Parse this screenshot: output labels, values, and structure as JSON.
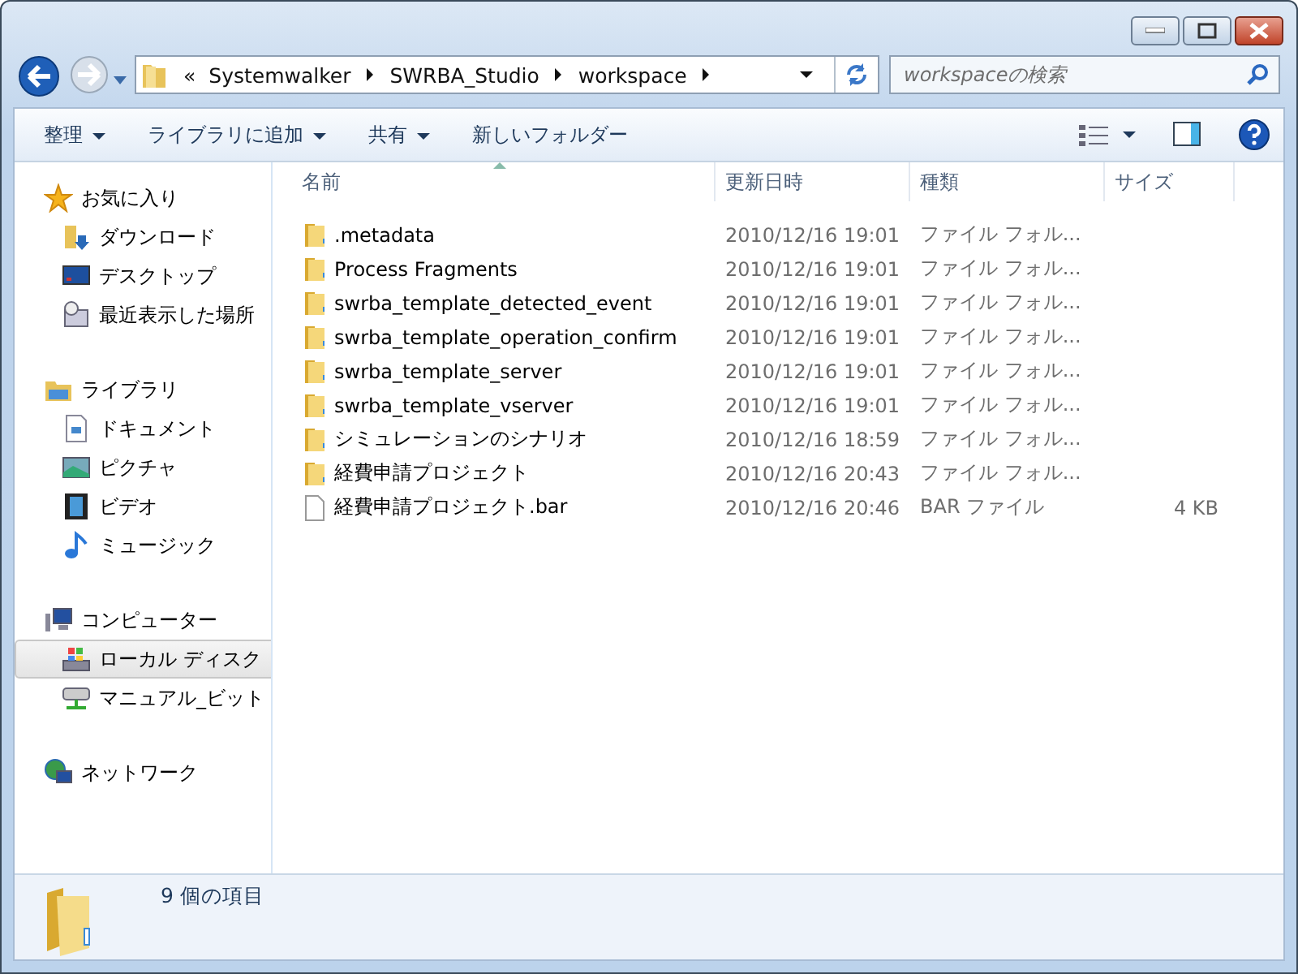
{
  "address": {
    "overflow": "«",
    "crumbs": [
      "Systemwalker",
      "SWRBA_Studio",
      "workspace"
    ]
  },
  "search": {
    "placeholder": "workspaceの検索"
  },
  "toolbar": {
    "buttons": [
      {
        "label": "整理",
        "dropdown": true
      },
      {
        "label": "ライブラリに追加",
        "dropdown": true
      },
      {
        "label": "共有",
        "dropdown": true
      },
      {
        "label": "新しいフォルダー",
        "dropdown": false
      }
    ]
  },
  "nav": [
    {
      "label": "お気に入り",
      "kind": "star",
      "selected": false,
      "children": [
        {
          "label": "ダウンロード",
          "kind": "download",
          "selected": false
        },
        {
          "label": "デスクトップ",
          "kind": "desktop",
          "selected": false
        },
        {
          "label": "最近表示した場所",
          "kind": "recent",
          "selected": false
        }
      ]
    },
    {
      "label": "ライブラリ",
      "kind": "library",
      "selected": false,
      "children": [
        {
          "label": "ドキュメント",
          "kind": "document",
          "selected": false
        },
        {
          "label": "ピクチャ",
          "kind": "picture",
          "selected": false
        },
        {
          "label": "ビデオ",
          "kind": "video",
          "selected": false
        },
        {
          "label": "ミュージック",
          "kind": "music",
          "selected": false
        }
      ]
    },
    {
      "label": "コンピューター",
      "kind": "computer",
      "selected": false,
      "children": [
        {
          "label": "ローカル ディスク",
          "kind": "disk",
          "selected": true
        },
        {
          "label": "マニュアル_ビット",
          "kind": "netdrive",
          "selected": false
        }
      ]
    },
    {
      "label": "ネットワーク",
      "kind": "network",
      "selected": false
    }
  ],
  "table": {
    "columns": [
      "名前",
      "更新日時",
      "種類",
      "サイズ"
    ],
    "rows": [
      {
        "kind": "folder",
        "name": ".metadata",
        "date": "2010/12/16 19:01",
        "type": "ファイル フォル...",
        "size": ""
      },
      {
        "kind": "folder",
        "name": "Process Fragments",
        "date": "2010/12/16 19:01",
        "type": "ファイル フォル...",
        "size": ""
      },
      {
        "kind": "folder",
        "name": "swrba_template_detected_event",
        "date": "2010/12/16 19:01",
        "type": "ファイル フォル...",
        "size": ""
      },
      {
        "kind": "folder",
        "name": "swrba_template_operation_confirm",
        "date": "2010/12/16 19:01",
        "type": "ファイル フォル...",
        "size": ""
      },
      {
        "kind": "folder",
        "name": "swrba_template_server",
        "date": "2010/12/16 19:01",
        "type": "ファイル フォル...",
        "size": ""
      },
      {
        "kind": "folder",
        "name": "swrba_template_vserver",
        "date": "2010/12/16 19:01",
        "type": "ファイル フォル...",
        "size": ""
      },
      {
        "kind": "folder",
        "name": "シミュレーションのシナリオ",
        "date": "2010/12/16 18:59",
        "type": "ファイル フォル...",
        "size": ""
      },
      {
        "kind": "folder",
        "name": "経費申請プロジェクト",
        "date": "2010/12/16 20:43",
        "type": "ファイル フォル...",
        "size": ""
      },
      {
        "kind": "file",
        "name": "経費申請プロジェクト.bar",
        "date": "2010/12/16 20:46",
        "type": "BAR ファイル",
        "size": "4 KB"
      }
    ]
  },
  "status_bar": {
    "text": "9 個の項目"
  }
}
